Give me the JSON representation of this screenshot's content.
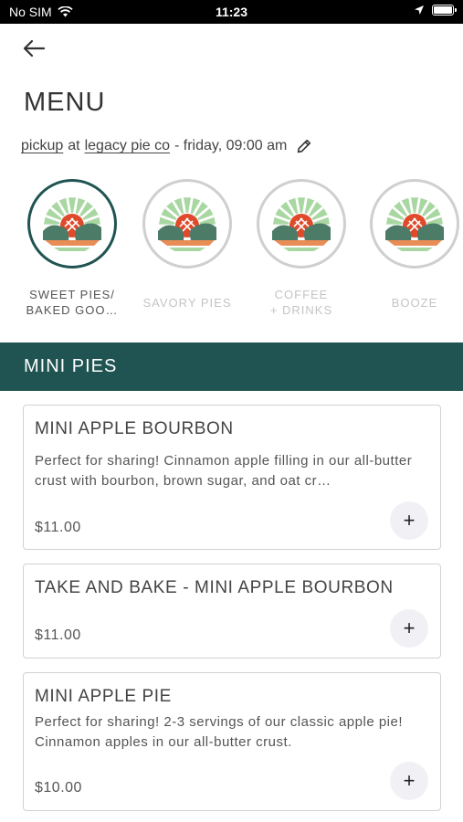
{
  "status_bar": {
    "carrier": "No SIM",
    "time": "11:23",
    "icons": [
      "wifi-icon",
      "location-arrow-icon",
      "battery-icon"
    ]
  },
  "header": {
    "back_icon": "arrow-left-icon",
    "title": "MENU"
  },
  "order_info": {
    "method": "pickup",
    "at": "at",
    "location": "legacy pie co",
    "time": "- friday, 09:00 am",
    "edit_icon": "pencil-icon"
  },
  "categories": [
    {
      "label_line1": "SWEET PIES/",
      "label_line2": "BAKED GOO…",
      "active": true
    },
    {
      "label_line1": "SAVORY PIES",
      "label_line2": "",
      "active": false
    },
    {
      "label_line1": "COFFEE",
      "label_line2": "+ DRINKS",
      "active": false
    },
    {
      "label_line1": "BOOZE",
      "label_line2": "",
      "active": false
    }
  ],
  "section": {
    "title": "MINI PIES"
  },
  "items": [
    {
      "name": "MINI APPLE BOURBON",
      "description": "Perfect for sharing! Cinnamon apple filling in our all-butter crust with bourbon, brown sugar, and oat cr…",
      "price": "$11.00",
      "add_label": "+"
    },
    {
      "name": "TAKE AND BAKE - MINI APPLE BOURBON",
      "description": "",
      "price": "$11.00",
      "add_label": "+"
    },
    {
      "name": "MINI APPLE PIE",
      "description": "Perfect for sharing! 2-3 servings of our classic apple pie! Cinnamon apples in our all-butter crust.",
      "price": "$10.00",
      "add_label": "+"
    }
  ],
  "colors": {
    "brand_teal": "#1f5452",
    "logo_light_green": "#a9d7a2",
    "logo_dark_green": "#4c7b67",
    "logo_red": "#df4a2b",
    "logo_orange": "#e98d56"
  }
}
